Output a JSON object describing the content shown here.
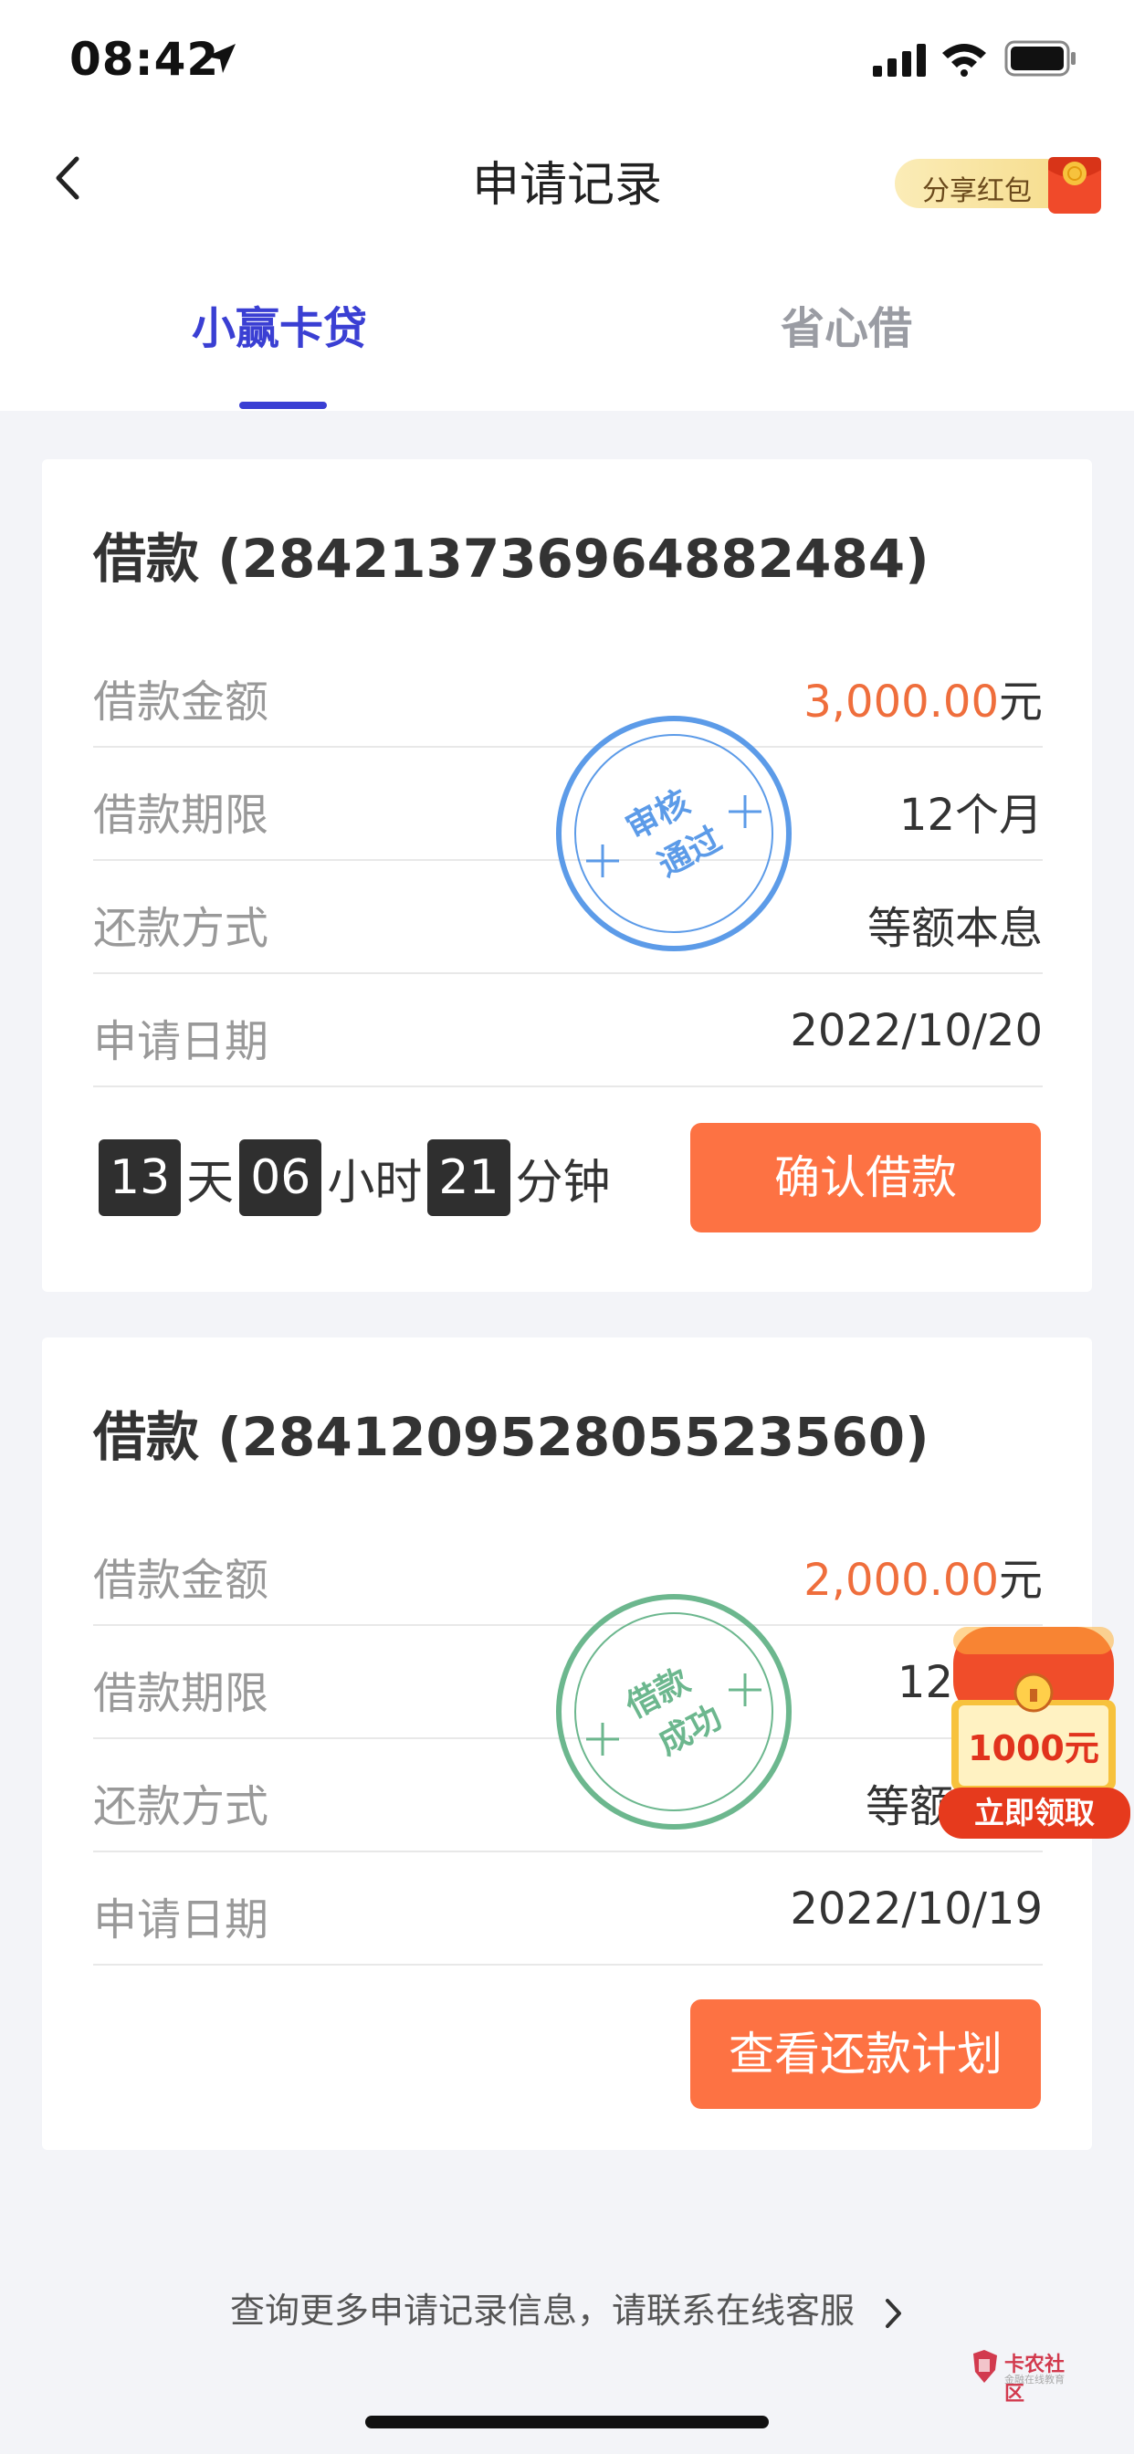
{
  "status_bar": {
    "time": "08:42"
  },
  "nav": {
    "title": "申请记录",
    "share_label": "分享红包"
  },
  "tabs": [
    {
      "label": "小赢卡贷",
      "active": true
    },
    {
      "label": "省心借",
      "active": false
    }
  ],
  "colors": {
    "accent": "#3a3fd3",
    "button": "#fd7243",
    "amount": "#ef6e3c",
    "stamp_blue": "#5c9be8",
    "stamp_green": "#6cb78e"
  },
  "loans": [
    {
      "title": "借款 (284213736964882484)",
      "rows": [
        {
          "label": "借款金额",
          "amount": "3,000.00",
          "unit": "元"
        },
        {
          "label": "借款期限",
          "value": "12个月"
        },
        {
          "label": "还款方式",
          "value": "等额本息"
        },
        {
          "label": "申请日期",
          "value": "2022/10/20"
        }
      ],
      "stamp": {
        "line1": "审核",
        "line2": "通过"
      },
      "countdown": {
        "days": "13",
        "days_unit": "天",
        "hours": "06",
        "hours_unit": "小时",
        "minutes": "21",
        "minutes_unit": "分钟"
      },
      "button": "确认借款"
    },
    {
      "title": "借款 (284120952805523560)",
      "rows": [
        {
          "label": "借款金额",
          "amount": "2,000.00",
          "unit": "元"
        },
        {
          "label": "借款期限",
          "value": "12"
        },
        {
          "label": "还款方式",
          "value": "等额"
        },
        {
          "label": "申请日期",
          "value": "2022/10/19"
        }
      ],
      "stamp": {
        "line1": "借款",
        "line2": "成功"
      },
      "button": "查看还款计划"
    }
  ],
  "promo": {
    "amount": "1000元",
    "action": "立即领取"
  },
  "footer": {
    "link": "查询更多申请记录信息，请联系在线客服"
  },
  "watermark": {
    "text": "卡农社区",
    "sub": "金融在线教育"
  }
}
